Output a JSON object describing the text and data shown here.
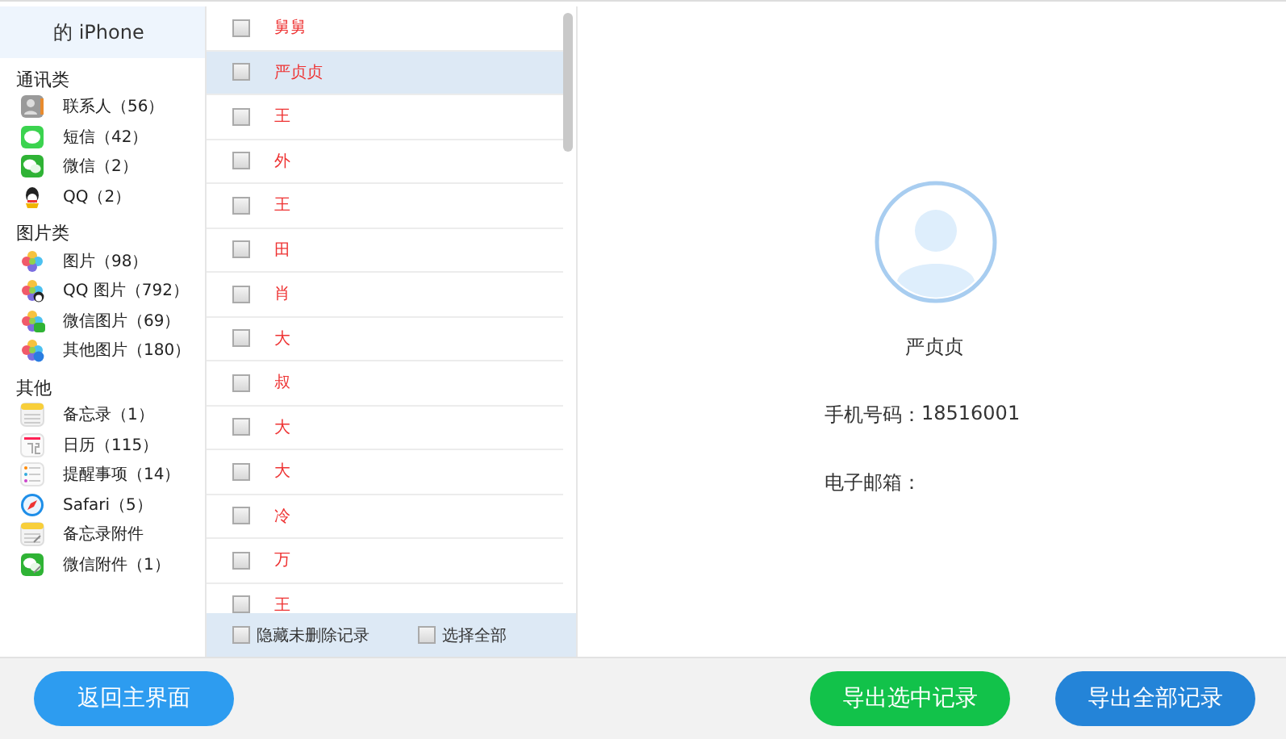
{
  "device": {
    "title": "的 iPhone"
  },
  "sidebar": {
    "groups": [
      {
        "label": "通讯类",
        "items": [
          {
            "label": "联系人（56）",
            "kind": "contacts",
            "selected": false
          },
          {
            "label": "短信（42）",
            "kind": "sms",
            "selected": false
          },
          {
            "label": "微信（2）",
            "kind": "wechat",
            "selected": false
          },
          {
            "label": "QQ（2）",
            "kind": "qq",
            "selected": false
          }
        ]
      },
      {
        "label": "图片类",
        "items": [
          {
            "label": "图片（98）",
            "kind": "photos",
            "selected": false
          },
          {
            "label": "QQ 图片（792）",
            "kind": "qq-photos",
            "selected": false
          },
          {
            "label": "微信图片（69）",
            "kind": "wechat-photos",
            "selected": false
          },
          {
            "label": "其他图片（180）",
            "kind": "other-photos",
            "selected": false
          }
        ]
      },
      {
        "label": "其他",
        "items": [
          {
            "label": "备忘录（1）",
            "kind": "notes",
            "selected": false
          },
          {
            "label": "日历（115）",
            "kind": "calendar",
            "selected": false
          },
          {
            "label": "提醒事项（14）",
            "kind": "reminders",
            "selected": false
          },
          {
            "label": "Safari（5）",
            "kind": "safari",
            "selected": false
          },
          {
            "label": "备忘录附件",
            "kind": "notes-attach",
            "selected": false
          },
          {
            "label": "微信附件（1）",
            "kind": "wechat-attach",
            "selected": false
          }
        ]
      }
    ]
  },
  "contacts": [
    {
      "name": "舅舅",
      "checked": false,
      "selected": false
    },
    {
      "name": "严贞贞",
      "checked": false,
      "selected": true
    },
    {
      "name": "王",
      "checked": false,
      "selected": false
    },
    {
      "name": "外",
      "checked": false,
      "selected": false
    },
    {
      "name": "王",
      "checked": false,
      "selected": false
    },
    {
      "name": "田",
      "checked": false,
      "selected": false
    },
    {
      "name": "肖",
      "checked": false,
      "selected": false
    },
    {
      "name": "大",
      "checked": false,
      "selected": false
    },
    {
      "name": "叔",
      "checked": false,
      "selected": false
    },
    {
      "name": "大",
      "checked": false,
      "selected": false
    },
    {
      "name": "大",
      "checked": false,
      "selected": false
    },
    {
      "name": "冷",
      "checked": false,
      "selected": false
    },
    {
      "name": "万",
      "checked": false,
      "selected": false
    },
    {
      "name": "王",
      "checked": false,
      "selected": false
    }
  ],
  "list_options": [
    {
      "label": "隐藏未删除记录",
      "checked": false
    },
    {
      "label": "选择全部",
      "checked": false
    }
  ],
  "detail": {
    "name": "严贞贞",
    "fields": [
      {
        "label": "手机号码：",
        "value": "18516001"
      },
      {
        "label": "电子邮箱："
      }
    ]
  },
  "footer": {
    "back_button": "返回主界面",
    "export_selected_button": "导出选中记录",
    "export_all_button": "导出全部记录"
  }
}
